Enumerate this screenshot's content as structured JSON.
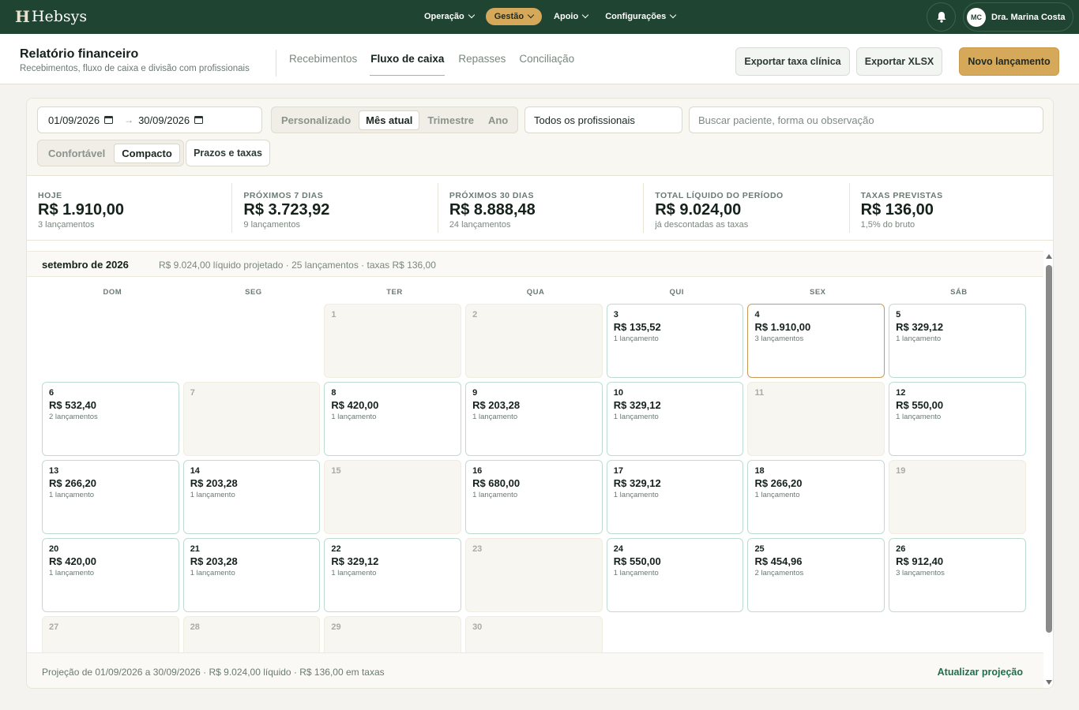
{
  "app": {
    "brand_mark": "H",
    "brand_name": "Hebsys",
    "menu": [
      {
        "label": "Operação"
      },
      {
        "label": "Gestão"
      },
      {
        "label": "Apoio"
      },
      {
        "label": "Configurações"
      }
    ],
    "user": {
      "initials": "MC",
      "name": "Dra. Marina Costa"
    }
  },
  "header": {
    "title": "Relatório financeiro",
    "subtitle": "Recebimentos, fluxo de caixa e divisão com profissionais",
    "tabs": [
      {
        "label": "Recebimentos"
      },
      {
        "label": "Fluxo de caixa"
      },
      {
        "label": "Repasses"
      },
      {
        "label": "Conciliação"
      }
    ],
    "export_fee_label": "Exportar taxa clínica",
    "export_xlsx_label": "Exportar XLSX",
    "new_entry_label": "Novo lançamento"
  },
  "filters": {
    "date_from": "01/09/2026",
    "date_to": "30/09/2026",
    "arrow": "→",
    "periods": [
      "Personalizado",
      "Mês atual",
      "Trimestre",
      "Ano"
    ],
    "period_selected": "Mês atual",
    "professional": "Todos os profissionais",
    "search_placeholder": "Buscar paciente, forma ou observação",
    "density": [
      "Confortável",
      "Compacto"
    ],
    "density_selected": "Compacto",
    "terms_label": "Prazos e taxas"
  },
  "summary": [
    {
      "label": "HOJE",
      "value": "R$ 1.910,00",
      "sub": "3 lançamentos"
    },
    {
      "label": "PRÓXIMOS 7 DIAS",
      "value": "R$ 3.723,92",
      "sub": "9 lançamentos"
    },
    {
      "label": "PRÓXIMOS 30 DIAS",
      "value": "R$ 8.888,48",
      "sub": "24 lançamentos"
    },
    {
      "label": "TOTAL LÍQUIDO DO PERÍODO",
      "value": "R$ 9.024,00",
      "sub": "já descontadas as taxas"
    },
    {
      "label": "TAXAS PREVISTAS",
      "value": "R$ 136,00",
      "sub": "1,5% do bruto"
    }
  ],
  "calendar": {
    "month": "setembro de 2026",
    "meta": "R$ 9.024,00 líquido projetado · 25 lançamentos · taxas R$ 136,00",
    "weekdays": [
      "DOM",
      "SEG",
      "TER",
      "QUA",
      "QUI",
      "SEX",
      "SÁB"
    ],
    "leading_blanks": 2,
    "today": 4,
    "days": [
      {
        "day": "1"
      },
      {
        "day": "2"
      },
      {
        "day": "3",
        "amount": "R$ 135,52",
        "count": "1 lançamento"
      },
      {
        "day": "4",
        "amount": "R$ 1.910,00",
        "count": "3 lançamentos"
      },
      {
        "day": "5",
        "amount": "R$ 329,12",
        "count": "1 lançamento"
      },
      {
        "day": "6",
        "amount": "R$ 532,40",
        "count": "2 lançamentos"
      },
      {
        "day": "7"
      },
      {
        "day": "8",
        "amount": "R$ 420,00",
        "count": "1 lançamento"
      },
      {
        "day": "9",
        "amount": "R$ 203,28",
        "count": "1 lançamento"
      },
      {
        "day": "10",
        "amount": "R$ 329,12",
        "count": "1 lançamento"
      },
      {
        "day": "11"
      },
      {
        "day": "12",
        "amount": "R$ 550,00",
        "count": "1 lançamento"
      },
      {
        "day": "13",
        "amount": "R$ 266,20",
        "count": "1 lançamento"
      },
      {
        "day": "14",
        "amount": "R$ 203,28",
        "count": "1 lançamento"
      },
      {
        "day": "15"
      },
      {
        "day": "16",
        "amount": "R$ 680,00",
        "count": "1 lançamento"
      },
      {
        "day": "17",
        "amount": "R$ 329,12",
        "count": "1 lançamento"
      },
      {
        "day": "18",
        "amount": "R$ 266,20",
        "count": "1 lançamento"
      },
      {
        "day": "19"
      },
      {
        "day": "20",
        "amount": "R$ 420,00",
        "count": "1 lançamento"
      },
      {
        "day": "21",
        "amount": "R$ 203,28",
        "count": "1 lançamento"
      },
      {
        "day": "22",
        "amount": "R$ 329,12",
        "count": "1 lançamento"
      },
      {
        "day": "23"
      },
      {
        "day": "24",
        "amount": "R$ 550,00",
        "count": "1 lançamento"
      },
      {
        "day": "25",
        "amount": "R$ 454,96",
        "count": "2 lançamentos"
      },
      {
        "day": "26",
        "amount": "R$ 912,40",
        "count": "3 lançamentos"
      },
      {
        "day": "27"
      },
      {
        "day": "28"
      },
      {
        "day": "29"
      },
      {
        "day": "30"
      }
    ]
  },
  "footer": {
    "text": "Projeção de 01/09/2026 a 30/09/2026 · R$ 9.024,00 líquido · R$ 136,00 em taxas",
    "refresh_label": "Atualizar projeção"
  },
  "colors": {
    "nav_bg": "#1f4532",
    "accent": "#d6a85a",
    "link": "#1f6f4a",
    "day_border": "#bfdcd1"
  }
}
